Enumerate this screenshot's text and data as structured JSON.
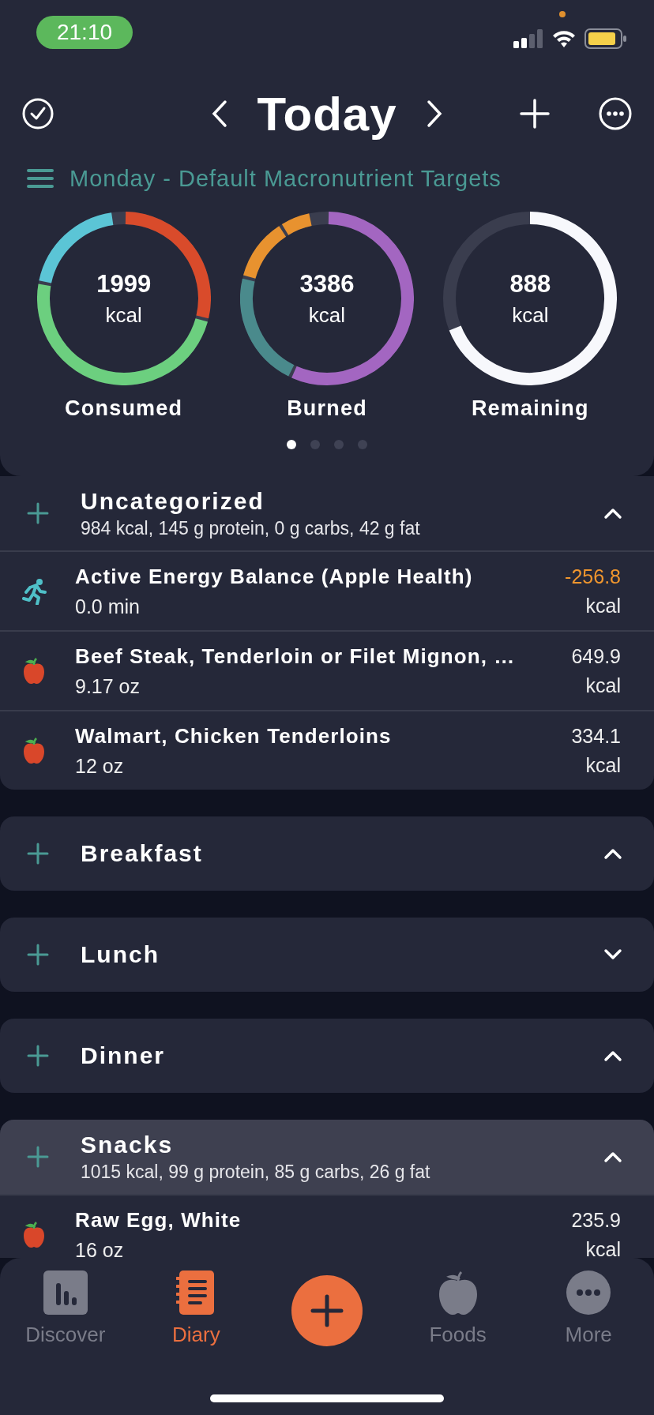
{
  "status_bar": {
    "time": "21:10"
  },
  "header": {
    "title": "Today",
    "subtitle": "Monday - Default Macronutrient Targets"
  },
  "rings": [
    {
      "value": "1999",
      "unit": "kcal",
      "label": "Consumed",
      "segments": [
        {
          "color": "#d94b2b"
        },
        {
          "color": "#6ccf7f"
        },
        {
          "color": "#5bc5d6"
        }
      ]
    },
    {
      "value": "3386",
      "unit": "kcal",
      "label": "Burned",
      "segments": [
        {
          "color": "#a366c1"
        },
        {
          "color": "#4a8a8c"
        },
        {
          "color": "#e8922f"
        },
        {
          "color": "#e8922f"
        }
      ]
    },
    {
      "value": "888",
      "unit": "kcal",
      "label": "Remaining",
      "segments": [
        {
          "color": "#f7f8fc"
        }
      ]
    }
  ],
  "page_dots": [
    {
      "selected": true
    },
    {
      "selected": false
    },
    {
      "selected": false
    },
    {
      "selected": false
    }
  ],
  "sections": [
    {
      "name": "Uncategorized",
      "summary": "984 kcal, 145 g protein, 0 g carbs, 42 g fat",
      "expanded": true,
      "highlighted": false,
      "items": [
        {
          "kind": "exercise",
          "name": "Active Energy Balance (Apple Health)",
          "amount": "0.0 min",
          "calories": "-256.8",
          "unit": "kcal"
        },
        {
          "kind": "food",
          "name": "Beef Steak, Tenderloin or Filet Mignon, …",
          "amount": "9.17 oz",
          "calories": "649.9",
          "unit": "kcal"
        },
        {
          "kind": "food",
          "name": "Walmart, Chicken Tenderloins",
          "amount": "12 oz",
          "calories": "334.1",
          "unit": "kcal"
        }
      ]
    },
    {
      "name": "Breakfast",
      "expanded": true,
      "highlighted": false
    },
    {
      "name": "Lunch",
      "expanded": false,
      "highlighted": false
    },
    {
      "name": "Dinner",
      "expanded": true,
      "highlighted": false
    },
    {
      "name": "Snacks",
      "summary": "1015 kcal, 99 g protein, 85 g carbs, 26 g fat",
      "expanded": true,
      "highlighted": true,
      "items": [
        {
          "kind": "food",
          "name": "Raw Egg, White",
          "amount": "16 oz",
          "calories": "235.9",
          "unit": "kcal"
        }
      ]
    }
  ],
  "tab_bar": [
    {
      "kind": "discover",
      "label": "Discover",
      "selected": false
    },
    {
      "kind": "diary",
      "label": "Diary",
      "selected": true
    },
    {
      "kind": "add"
    },
    {
      "kind": "foods",
      "label": "Foods",
      "selected": false
    },
    {
      "kind": "more",
      "label": "More",
      "selected": false
    }
  ]
}
